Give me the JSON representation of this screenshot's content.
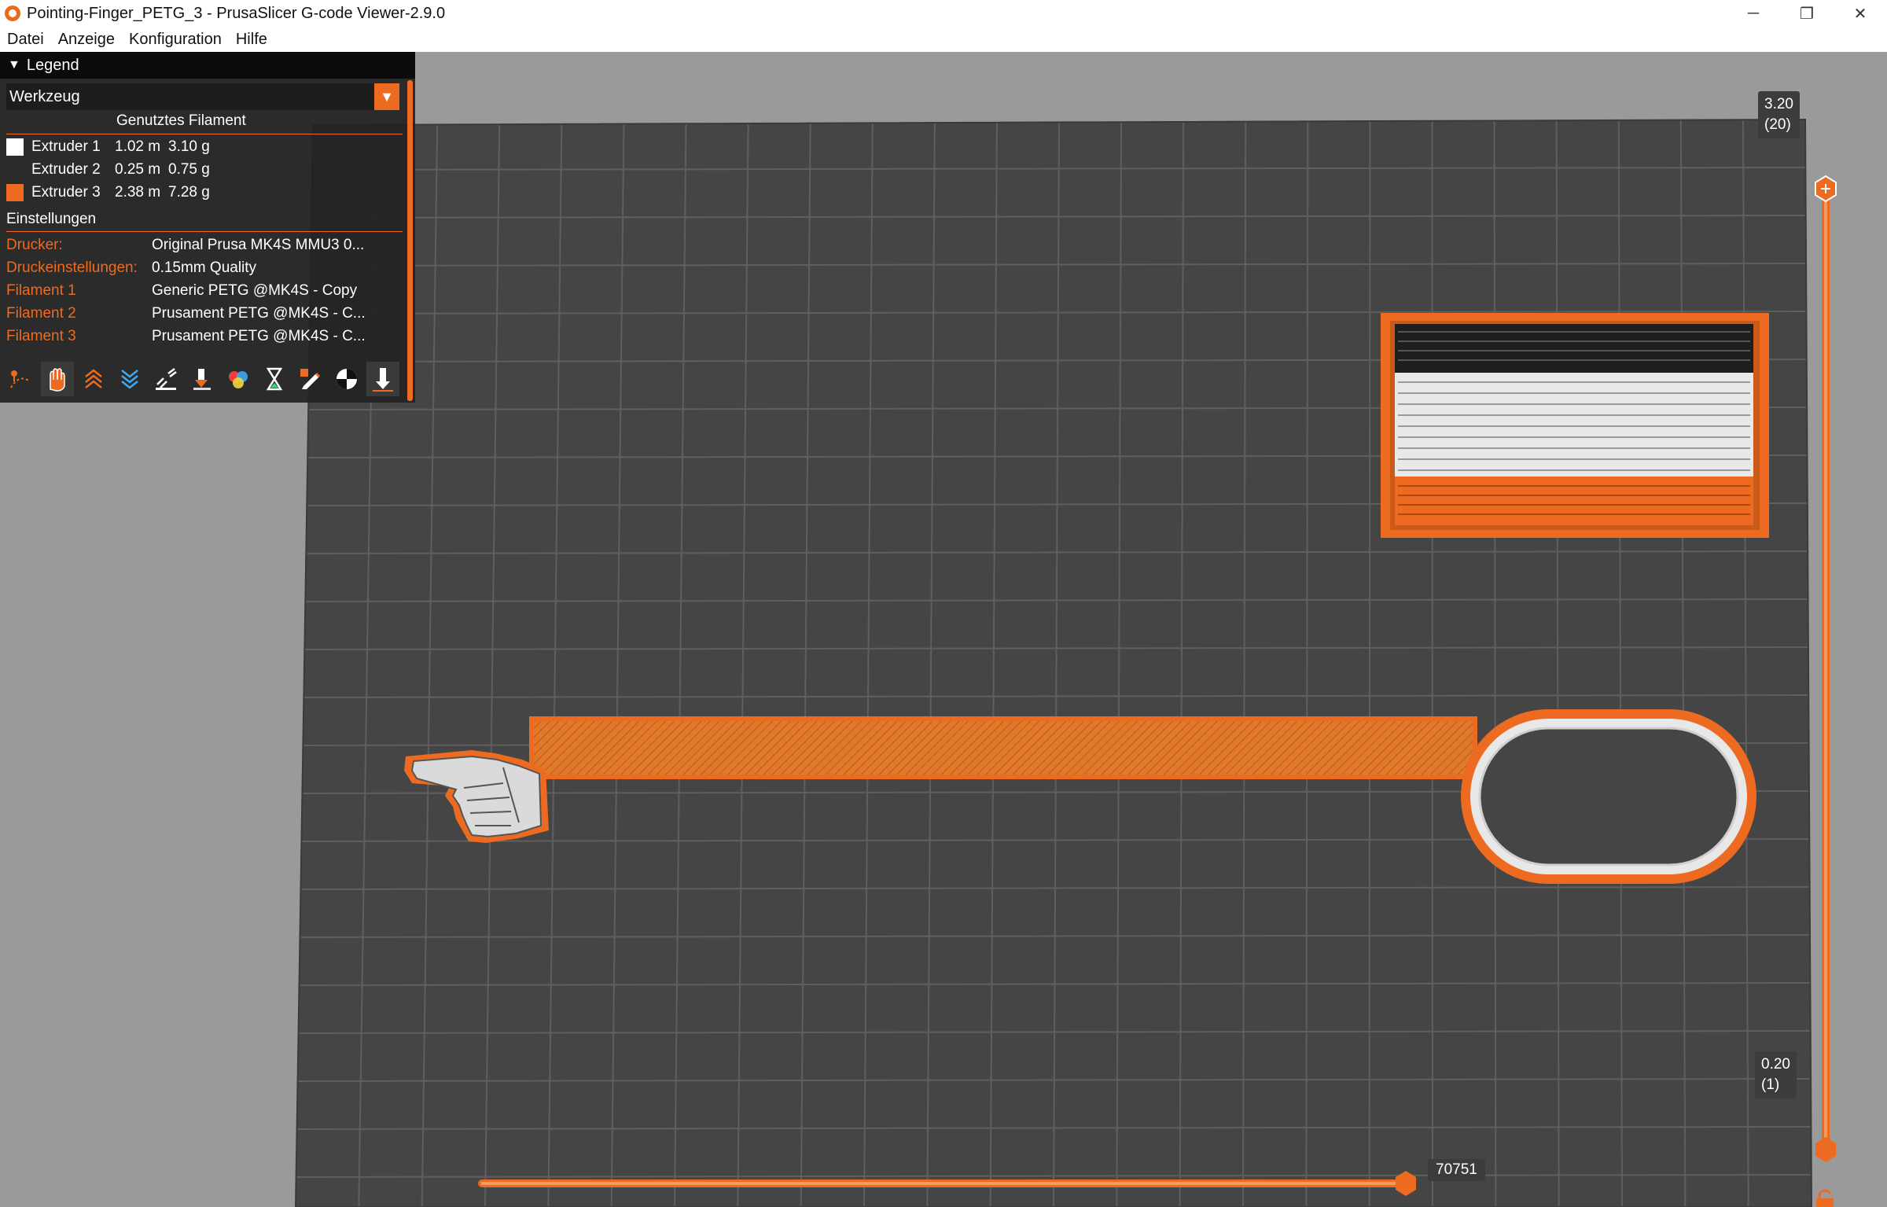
{
  "window": {
    "title": "Pointing-Finger_PETG_3 - PrusaSlicer G-code Viewer-2.9.0",
    "controls": [
      "─",
      "❐",
      "✕"
    ]
  },
  "menu": [
    "Datei",
    "Anzeige",
    "Konfiguration",
    "Hilfe"
  ],
  "legend": {
    "header": "Legend",
    "view_type": "Werkzeug",
    "used_filament_title": "Genutztes Filament",
    "extruders": [
      {
        "name": "Extruder 1",
        "length": "1.02 m",
        "weight": "3.10 g",
        "color": "#ffffff"
      },
      {
        "name": "Extruder 2",
        "length": "0.25 m",
        "weight": "0.75 g",
        "color": "#2b2b2b"
      },
      {
        "name": "Extruder 3",
        "length": "2.38 m",
        "weight": "7.28 g",
        "color": "#ed6b21"
      }
    ],
    "settings_title": "Einstellungen",
    "settings": [
      {
        "key": "Drucker:",
        "value": "Original Prusa MK4S MMU3 0..."
      },
      {
        "key": "Druckeinstellungen:",
        "value": "0.15mm Quality"
      },
      {
        "key": "Filament 1",
        "value": "Generic PETG @MK4S - Copy"
      },
      {
        "key": "Filament 2",
        "value": "Prusament PETG @MK4S - C..."
      },
      {
        "key": "Filament 3",
        "value": "Prusament PETG @MK4S - C..."
      }
    ],
    "toolbar_icons": [
      "travel-icon",
      "retractions-icon",
      "deretractions-icon",
      "seams-icon",
      "wipe-icon",
      "tool-change-icon",
      "color-change-icon",
      "pause-icon",
      "custom-gcode-icon",
      "center-of-gravity-icon",
      "shells-icon"
    ]
  },
  "vertical_slider": {
    "top_value": "3.20",
    "top_layer": "(20)",
    "bottom_value": "0.20",
    "bottom_layer": "(1)",
    "level": 1.0
  },
  "horizontal_slider": {
    "value": "70751",
    "level": 1.0
  },
  "colors": {
    "accent": "#ed6b21",
    "bed": "#454545",
    "grid": "#5d5d5d",
    "background": "#9a9a9a"
  }
}
